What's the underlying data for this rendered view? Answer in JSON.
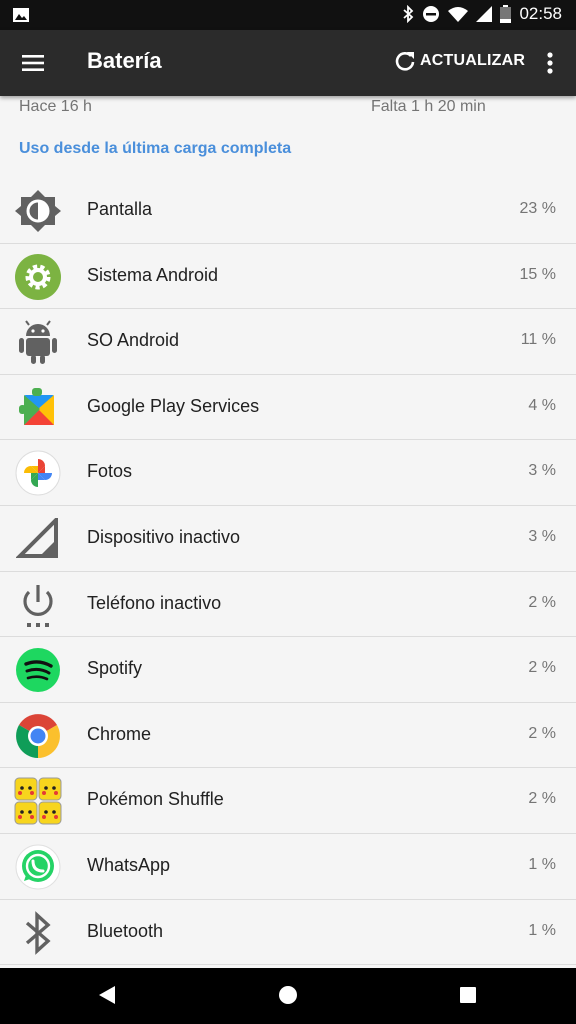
{
  "status_bar": {
    "time": "02:58",
    "icons": [
      "image-icon",
      "bluetooth-icon",
      "do-not-disturb-icon",
      "wifi-icon",
      "signal-icon",
      "battery-icon"
    ]
  },
  "app_bar": {
    "title": "Batería",
    "refresh_label": "ACTUALIZAR",
    "background": "#2b2b2b"
  },
  "time_info": {
    "since": "Hace 16 h",
    "remaining": "Falta 1 h 20 min"
  },
  "section_header": {
    "label": "Uso desde la última carga completa",
    "color": "#4a8fdb"
  },
  "items": [
    {
      "name": "Pantalla",
      "percent": "23 %",
      "icon": "brightness-icon"
    },
    {
      "name": "Sistema Android",
      "percent": "15 %",
      "icon": "android-system-gear-icon"
    },
    {
      "name": "SO Android",
      "percent": "11 %",
      "icon": "android-robot-icon"
    },
    {
      "name": "Google Play Services",
      "percent": "4 %",
      "icon": "play-services-icon"
    },
    {
      "name": "Fotos",
      "percent": "3 %",
      "icon": "photos-pinwheel-icon"
    },
    {
      "name": "Dispositivo inactivo",
      "percent": "3 %",
      "icon": "signal-triangle-icon"
    },
    {
      "name": "Teléfono inactivo",
      "percent": "2 %",
      "icon": "power-icon"
    },
    {
      "name": "Spotify",
      "percent": "2 %",
      "icon": "spotify-icon"
    },
    {
      "name": "Chrome",
      "percent": "2 %",
      "icon": "chrome-icon"
    },
    {
      "name": "Pokémon Shuffle",
      "percent": "2 %",
      "icon": "pokemon-shuffle-icon"
    },
    {
      "name": "WhatsApp",
      "percent": "1 %",
      "icon": "whatsapp-icon"
    },
    {
      "name": "Bluetooth",
      "percent": "1 %",
      "icon": "bluetooth-icon"
    }
  ],
  "nav_bar": {
    "buttons": [
      "back-icon",
      "home-icon",
      "recents-icon"
    ]
  }
}
